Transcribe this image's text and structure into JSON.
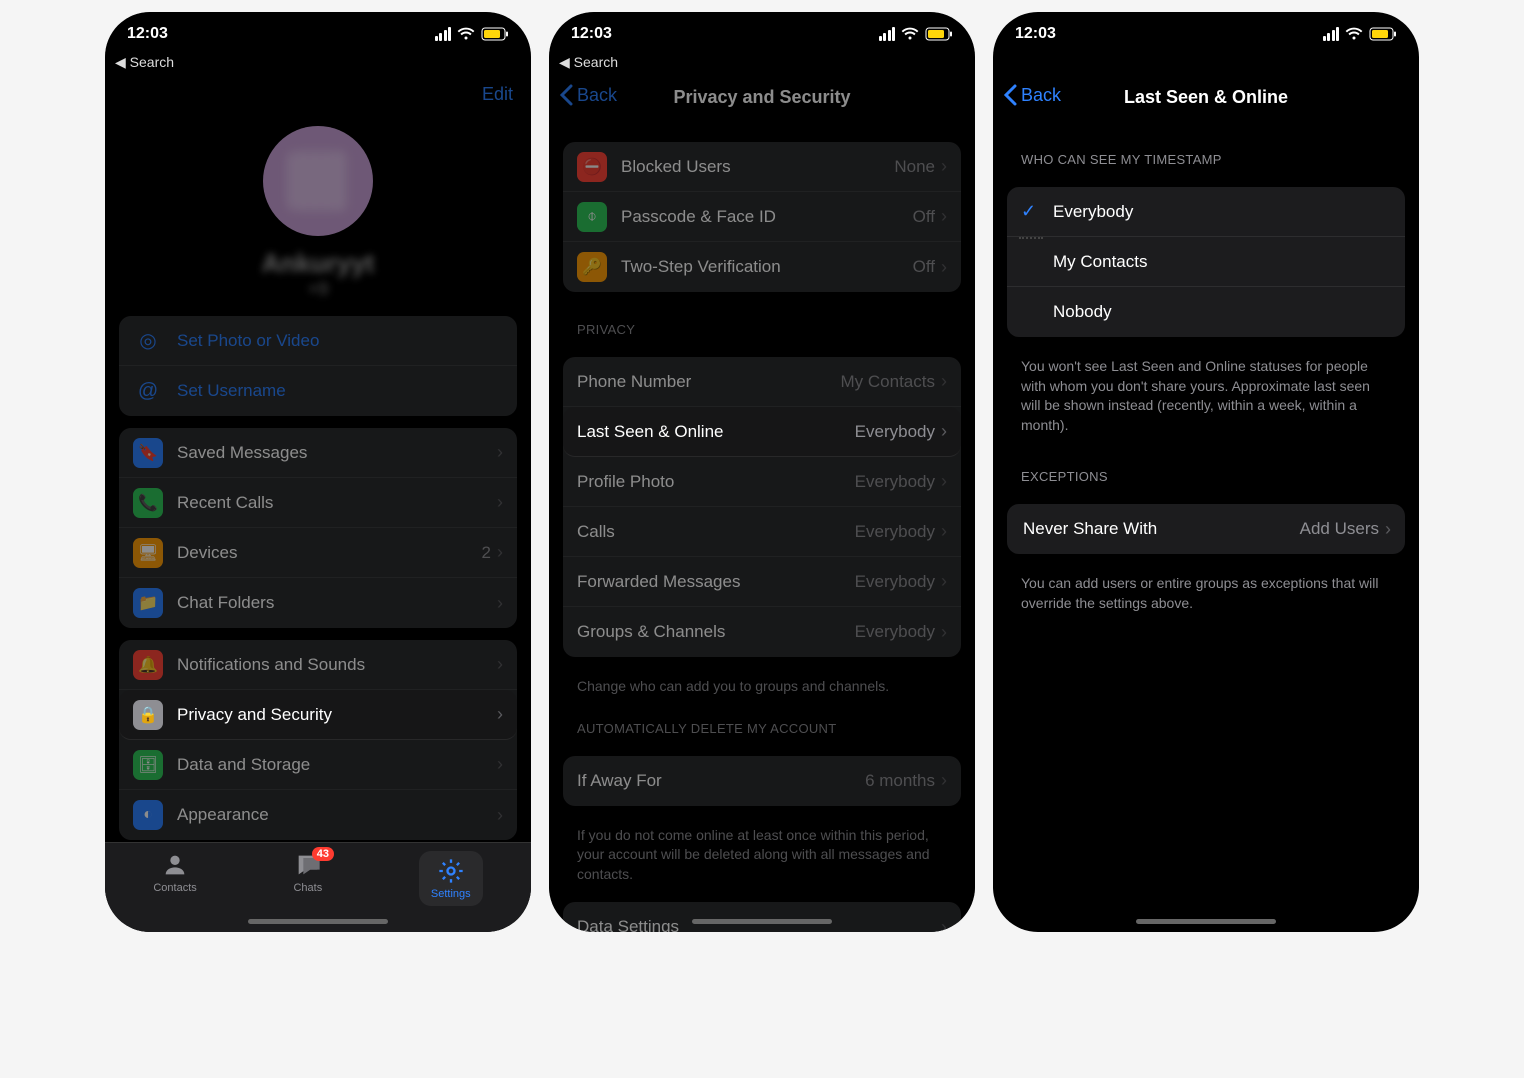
{
  "status": {
    "time": "12:03",
    "breadcrumb": "◀ Search"
  },
  "phone1": {
    "edit": "Edit",
    "name": "Ankuryyt",
    "phone": "+9",
    "set_photo": "Set Photo or Video",
    "set_username": "Set Username",
    "items1": [
      {
        "icon": "bookmark",
        "color": "#2f82ff",
        "label": "Saved Messages"
      },
      {
        "icon": "phone",
        "color": "#31c75a",
        "label": "Recent Calls"
      },
      {
        "icon": "devices",
        "color": "#ff9f0a",
        "label": "Devices",
        "value": "2"
      },
      {
        "icon": "folder",
        "color": "#2f82ff",
        "label": "Chat Folders"
      }
    ],
    "items2": [
      {
        "icon": "bell",
        "color": "#ff453a",
        "label": "Notifications and Sounds"
      },
      {
        "icon": "lock",
        "color": "#8e8e93",
        "label": "Privacy and Security",
        "hl": true
      },
      {
        "icon": "data",
        "color": "#31c75a",
        "label": "Data and Storage"
      },
      {
        "icon": "circle",
        "color": "#2f82ff",
        "label": "Appearance"
      }
    ],
    "tabs": {
      "contacts": "Contacts",
      "chats": "Chats",
      "chats_badge": "43",
      "settings": "Settings"
    }
  },
  "phone2": {
    "back": "Back",
    "title": "Privacy and Security",
    "sec1": [
      {
        "icon": "block",
        "color": "#ff453a",
        "label": "Blocked Users",
        "value": "None"
      },
      {
        "icon": "faceid",
        "color": "#31c75a",
        "label": "Passcode & Face ID",
        "value": "Off"
      },
      {
        "icon": "key",
        "color": "#ff9f0a",
        "label": "Two-Step Verification",
        "value": "Off"
      }
    ],
    "privacy_head": "Privacy",
    "sec2": [
      {
        "label": "Phone Number",
        "value": "My Contacts"
      },
      {
        "label": "Last Seen & Online",
        "value": "Everybody",
        "hl": true
      },
      {
        "label": "Profile Photo",
        "value": "Everybody"
      },
      {
        "label": "Calls",
        "value": "Everybody"
      },
      {
        "label": "Forwarded Messages",
        "value": "Everybody"
      },
      {
        "label": "Groups & Channels",
        "value": "Everybody"
      }
    ],
    "privacy_foot": "Change who can add you to groups and channels.",
    "delete_head": "Automatically Delete My Account",
    "sec3": {
      "label": "If Away For",
      "value": "6 months"
    },
    "delete_foot": "If you do not come online at least once within this period, your account will be deleted along with all messages and contacts.",
    "sec4": {
      "label": "Data Settings"
    }
  },
  "phone3": {
    "back": "Back",
    "title": "Last Seen & Online",
    "timestamp_head": "Who Can See My Timestamp",
    "options": [
      {
        "label": "Everybody",
        "selected": true
      },
      {
        "label": "My Contacts",
        "selected": false
      },
      {
        "label": "Nobody",
        "selected": false
      }
    ],
    "timestamp_foot": "You won't see Last Seen and Online statuses for people with whom you don't share yours. Approximate last seen will be shown instead (recently, within a week, within a month).",
    "exceptions_head": "Exceptions",
    "never_share": "Never Share With",
    "add_users": "Add Users",
    "exceptions_foot": "You can add users or entire groups as exceptions that will override the settings above."
  }
}
